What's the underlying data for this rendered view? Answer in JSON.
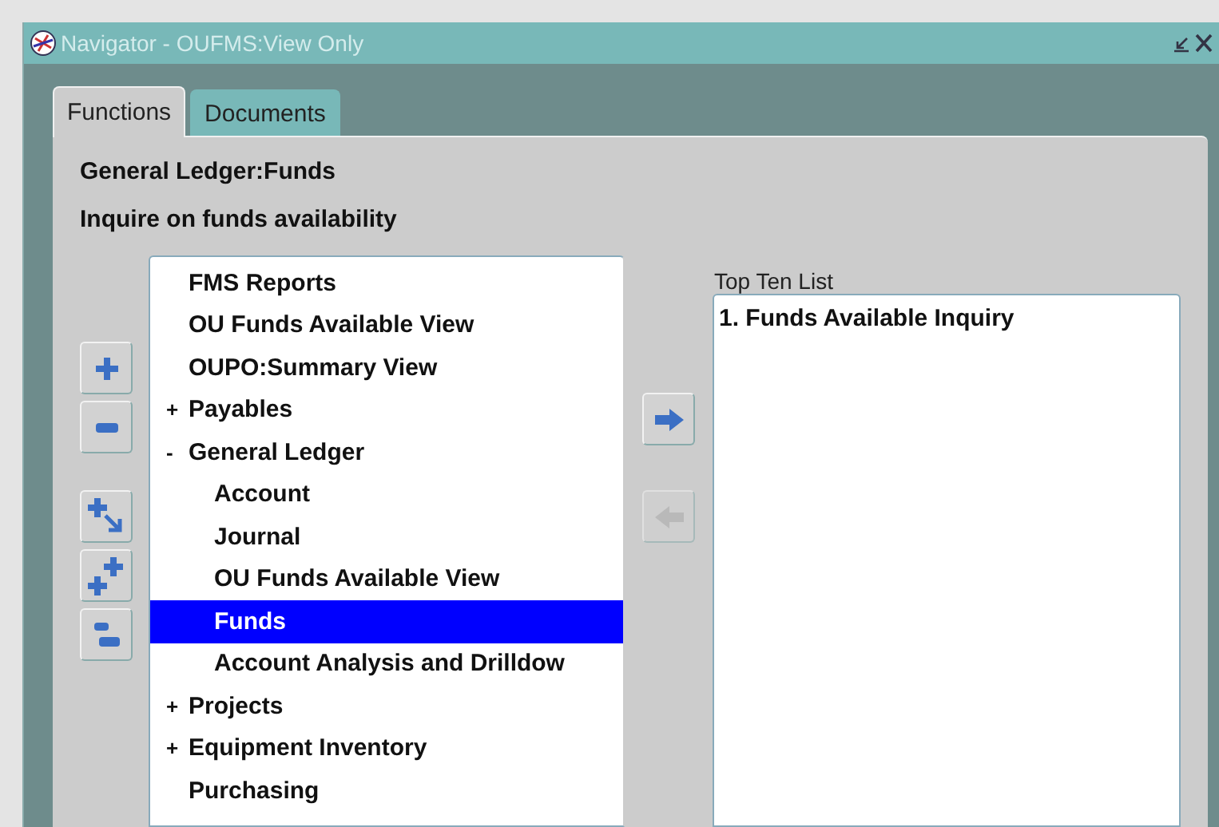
{
  "window": {
    "title": "Navigator - OUFMS:View Only"
  },
  "tabs": [
    {
      "label": "Functions",
      "selected": true
    },
    {
      "label": "Documents",
      "selected": false
    }
  ],
  "heading": "General Ledger:Funds",
  "description": "Inquire on funds availability",
  "tree": [
    {
      "label": "FMS Reports",
      "selected": false
    },
    {
      "label": "OU Funds Available View",
      "selected": false
    },
    {
      "label": "OUPO:Summary View",
      "selected": false
    },
    {
      "label": "Payables",
      "expander": "+",
      "selected": false
    },
    {
      "label": "General Ledger",
      "expander": "-",
      "selected": false,
      "children": [
        {
          "label": "Account",
          "selected": false
        },
        {
          "label": "Journal",
          "selected": false
        },
        {
          "label": "OU Funds Available View",
          "selected": false
        },
        {
          "label": "Funds",
          "selected": true
        },
        {
          "label": "Account Analysis and Drilldow",
          "selected": false
        }
      ]
    },
    {
      "label": "Projects",
      "expander": "+",
      "selected": false
    },
    {
      "label": "Equipment Inventory",
      "expander": "+",
      "selected": false
    },
    {
      "label": "Purchasing",
      "selected": false
    }
  ],
  "top_ten": {
    "label": "Top Ten List",
    "items": [
      "1. Funds Available Inquiry"
    ]
  },
  "tree_buttons": [
    {
      "kind": "expand",
      "disabled": false
    },
    {
      "kind": "collapse",
      "disabled": false
    },
    {
      "kind": "expand-branch",
      "disabled": false
    },
    {
      "kind": "expand-all",
      "disabled": false
    },
    {
      "kind": "collapse-all",
      "disabled": false
    }
  ],
  "transfer_buttons": [
    {
      "kind": "add",
      "disabled": false
    },
    {
      "kind": "remove",
      "disabled": true
    }
  ]
}
